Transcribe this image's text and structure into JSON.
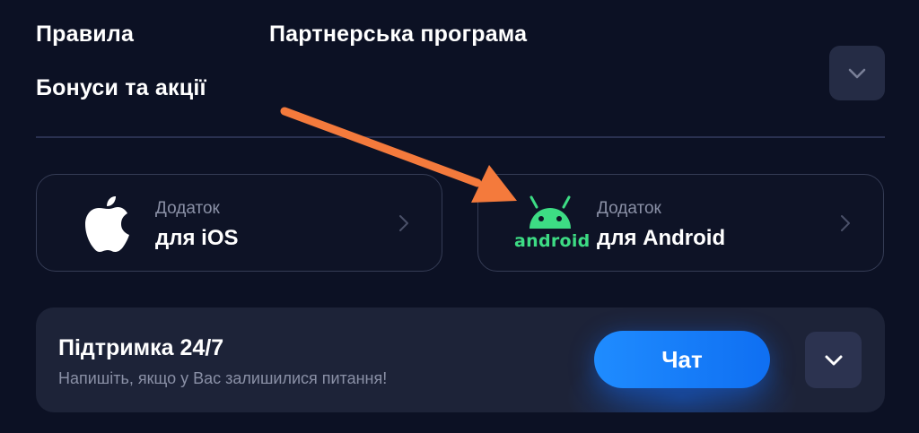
{
  "nav": {
    "rules": "Правила",
    "partner_program": "Партнерська програма",
    "bonuses": "Бонуси та акції"
  },
  "apps": {
    "ios": {
      "sub": "Додаток",
      "main": "для iOS",
      "icon": "apple-icon"
    },
    "android": {
      "sub": "Додаток",
      "main": "для Android",
      "icon": "android-icon",
      "logo_text": "android"
    }
  },
  "support": {
    "title": "Підтримка 24/7",
    "description": "Напишіть, якщо у Вас залишилися питання!",
    "chat_label": "Чат"
  },
  "colors": {
    "background": "#0c1124",
    "accent_blue": "#1a7dff",
    "android_green": "#3ddc84",
    "annotation_arrow": "#f47a3c"
  }
}
